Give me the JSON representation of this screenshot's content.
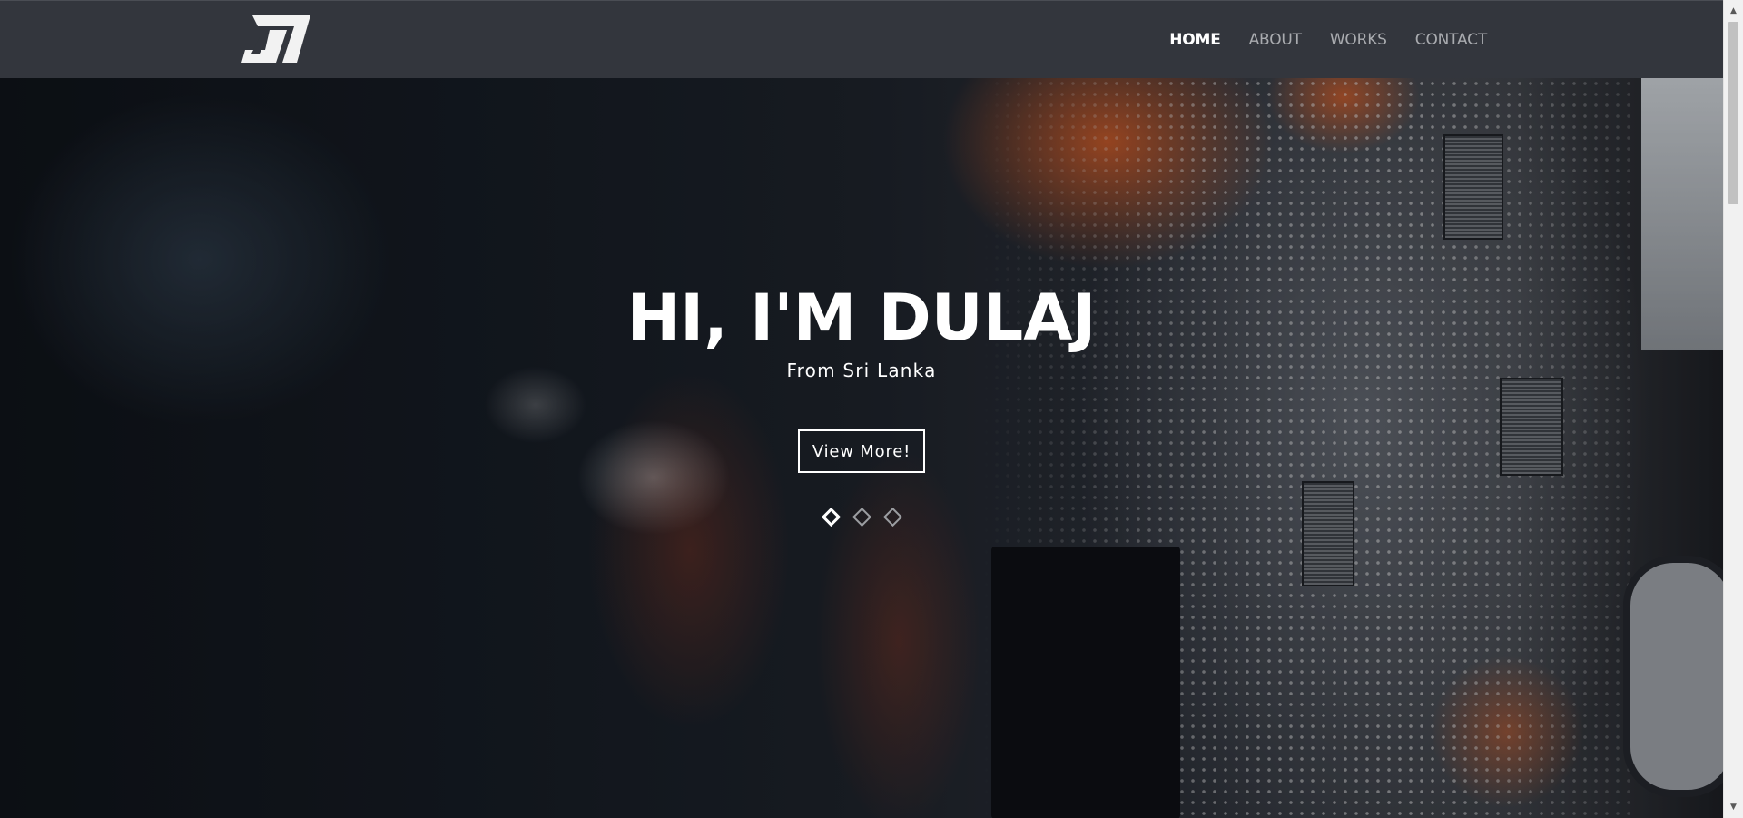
{
  "header": {
    "logo_icon": "dj-monogram-logo",
    "nav": [
      {
        "label": "HOME",
        "active": true
      },
      {
        "label": "ABOUT",
        "active": false
      },
      {
        "label": "WORKS",
        "active": false
      },
      {
        "label": "CONTACT",
        "active": false
      }
    ]
  },
  "hero": {
    "title": "HI, I'M DULAJ",
    "subtitle": "From Sri Lanka",
    "button_label": "View More!",
    "slides": {
      "count": 3,
      "active_index": 0
    },
    "background": "blurred-circuit-board-photo"
  },
  "colors": {
    "navbar_bg": "#33363d",
    "nav_active": "#ffffff",
    "nav_inactive": "#a9abaf",
    "accent_orange": "#d65c24"
  },
  "scrollbar": {
    "up_icon": "scroll-up-arrow-icon",
    "down_icon": "scroll-down-arrow-icon",
    "up_glyph": "▲",
    "down_glyph": "▼"
  }
}
